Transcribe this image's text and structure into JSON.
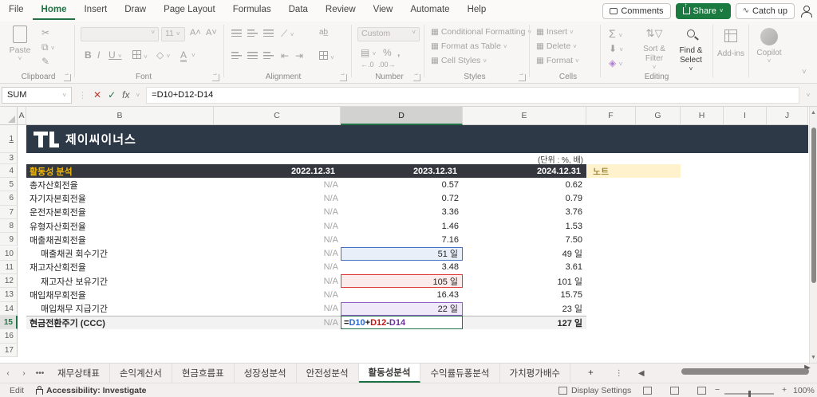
{
  "colors": {
    "accent_green": "#217346",
    "navy_band": "#2e3947",
    "table_header_bg": "#34383e",
    "title_gold": "#f2b705",
    "note_bg": "#fff2cc",
    "ref_blue": "#2c66c9",
    "ref_red": "#c01616",
    "ref_purple": "#7030a0"
  },
  "titlebar": {
    "tabs": [
      "File",
      "Home",
      "Insert",
      "Draw",
      "Page Layout",
      "Formulas",
      "Data",
      "Review",
      "View",
      "Automate",
      "Help"
    ],
    "active_tab": "Home",
    "comments_label": "Comments",
    "share_label": "Share",
    "catchup_label": "Catch up"
  },
  "ribbon": {
    "clipboard": {
      "label": "Clipboard",
      "paste_label": "Paste"
    },
    "font": {
      "label": "Font",
      "size_value": "11"
    },
    "alignment": {
      "label": "Alignment"
    },
    "number": {
      "label": "Number",
      "format_value": "Custom"
    },
    "styles": {
      "label": "Styles",
      "items": [
        "Conditional Formatting",
        "Format as Table",
        "Cell Styles"
      ]
    },
    "cells": {
      "label": "Cells",
      "items": [
        "Insert",
        "Delete",
        "Format"
      ]
    },
    "editing": {
      "label": "Editing",
      "sort_label": "Sort & Filter",
      "find_label": "Find & Select"
    },
    "addins_label": "Add-ins",
    "copilot_label": "Copilot"
  },
  "formula_bar": {
    "name_box": "SUM",
    "formula": "=D10+D12-D14"
  },
  "sheet": {
    "columns": [
      "A",
      "B",
      "C",
      "D",
      "E",
      "F",
      "G",
      "H",
      "I",
      "J"
    ],
    "selected_column": "D",
    "visible_rows": [
      1,
      3,
      4,
      5,
      6,
      7,
      8,
      9,
      10,
      11,
      12,
      13,
      14,
      15,
      16,
      17
    ],
    "active_row": 15,
    "logo_text": "제이씨이너스",
    "unit_note": "(단위 : %, 배)",
    "table": {
      "title": "활동성 분석",
      "date_headers": [
        "2022.12.31",
        "2023.12.31",
        "2024.12.31"
      ],
      "note_header": "노트",
      "rows": [
        {
          "row": 5,
          "label": "총자산회전율",
          "indent": false,
          "v2022": "N/A",
          "v2023": "0.57",
          "v2024": "0.62"
        },
        {
          "row": 6,
          "label": "자기자본회전율",
          "indent": false,
          "v2022": "N/A",
          "v2023": "0.72",
          "v2024": "0.79"
        },
        {
          "row": 7,
          "label": "운전자본회전율",
          "indent": false,
          "v2022": "N/A",
          "v2023": "3.36",
          "v2024": "3.76"
        },
        {
          "row": 8,
          "label": "유형자산회전율",
          "indent": false,
          "v2022": "N/A",
          "v2023": "1.46",
          "v2024": "1.53"
        },
        {
          "row": 9,
          "label": "매출채권회전율",
          "indent": false,
          "v2022": "N/A",
          "v2023": "7.16",
          "v2024": "7.50"
        },
        {
          "row": 10,
          "label": "매출채권 회수기간",
          "indent": true,
          "v2022": "N/A",
          "v2023": "51 일",
          "v2024": "49 일",
          "highlight": "blue"
        },
        {
          "row": 11,
          "label": "재고자산회전율",
          "indent": false,
          "v2022": "N/A",
          "v2023": "3.48",
          "v2024": "3.61"
        },
        {
          "row": 12,
          "label": "재고자산 보유기간",
          "indent": true,
          "v2022": "N/A",
          "v2023": "105 일",
          "v2024": "101 일",
          "highlight": "red"
        },
        {
          "row": 13,
          "label": "매입채무회전율",
          "indent": false,
          "v2022": "N/A",
          "v2023": "16.43",
          "v2024": "15.75"
        },
        {
          "row": 14,
          "label": "매입채무 지급기간",
          "indent": true,
          "v2022": "N/A",
          "v2023": "22 일",
          "v2024": "23 일",
          "highlight": "purple"
        },
        {
          "row": 15,
          "label": "현금전환주기 (CCC)",
          "indent": false,
          "bold": true,
          "total": true,
          "v2022": "N/A",
          "v2023_editing": true,
          "v2024": "127 일"
        }
      ],
      "formula_parts": [
        {
          "text": "=",
          "color": "#1a1a1a"
        },
        {
          "text": "D10",
          "color": "#2c66c9"
        },
        {
          "text": "+",
          "color": "#1a1a1a"
        },
        {
          "text": "D12",
          "color": "#c01616"
        },
        {
          "text": "-",
          "color": "#1a1a1a"
        },
        {
          "text": "D14",
          "color": "#7030a0"
        }
      ]
    }
  },
  "sheet_tabs": {
    "items": [
      "재무상태표",
      "손익계산서",
      "현금흐름표",
      "성장성분석",
      "안전성분석",
      "활동성분석",
      "수익률듀퐁분석",
      "가치평가배수"
    ],
    "active": "활동성분석",
    "add_label": "+"
  },
  "status_bar": {
    "mode": "Edit",
    "accessibility": "Accessibility: Investigate",
    "display_settings": "Display Settings",
    "zoom": "100%"
  }
}
